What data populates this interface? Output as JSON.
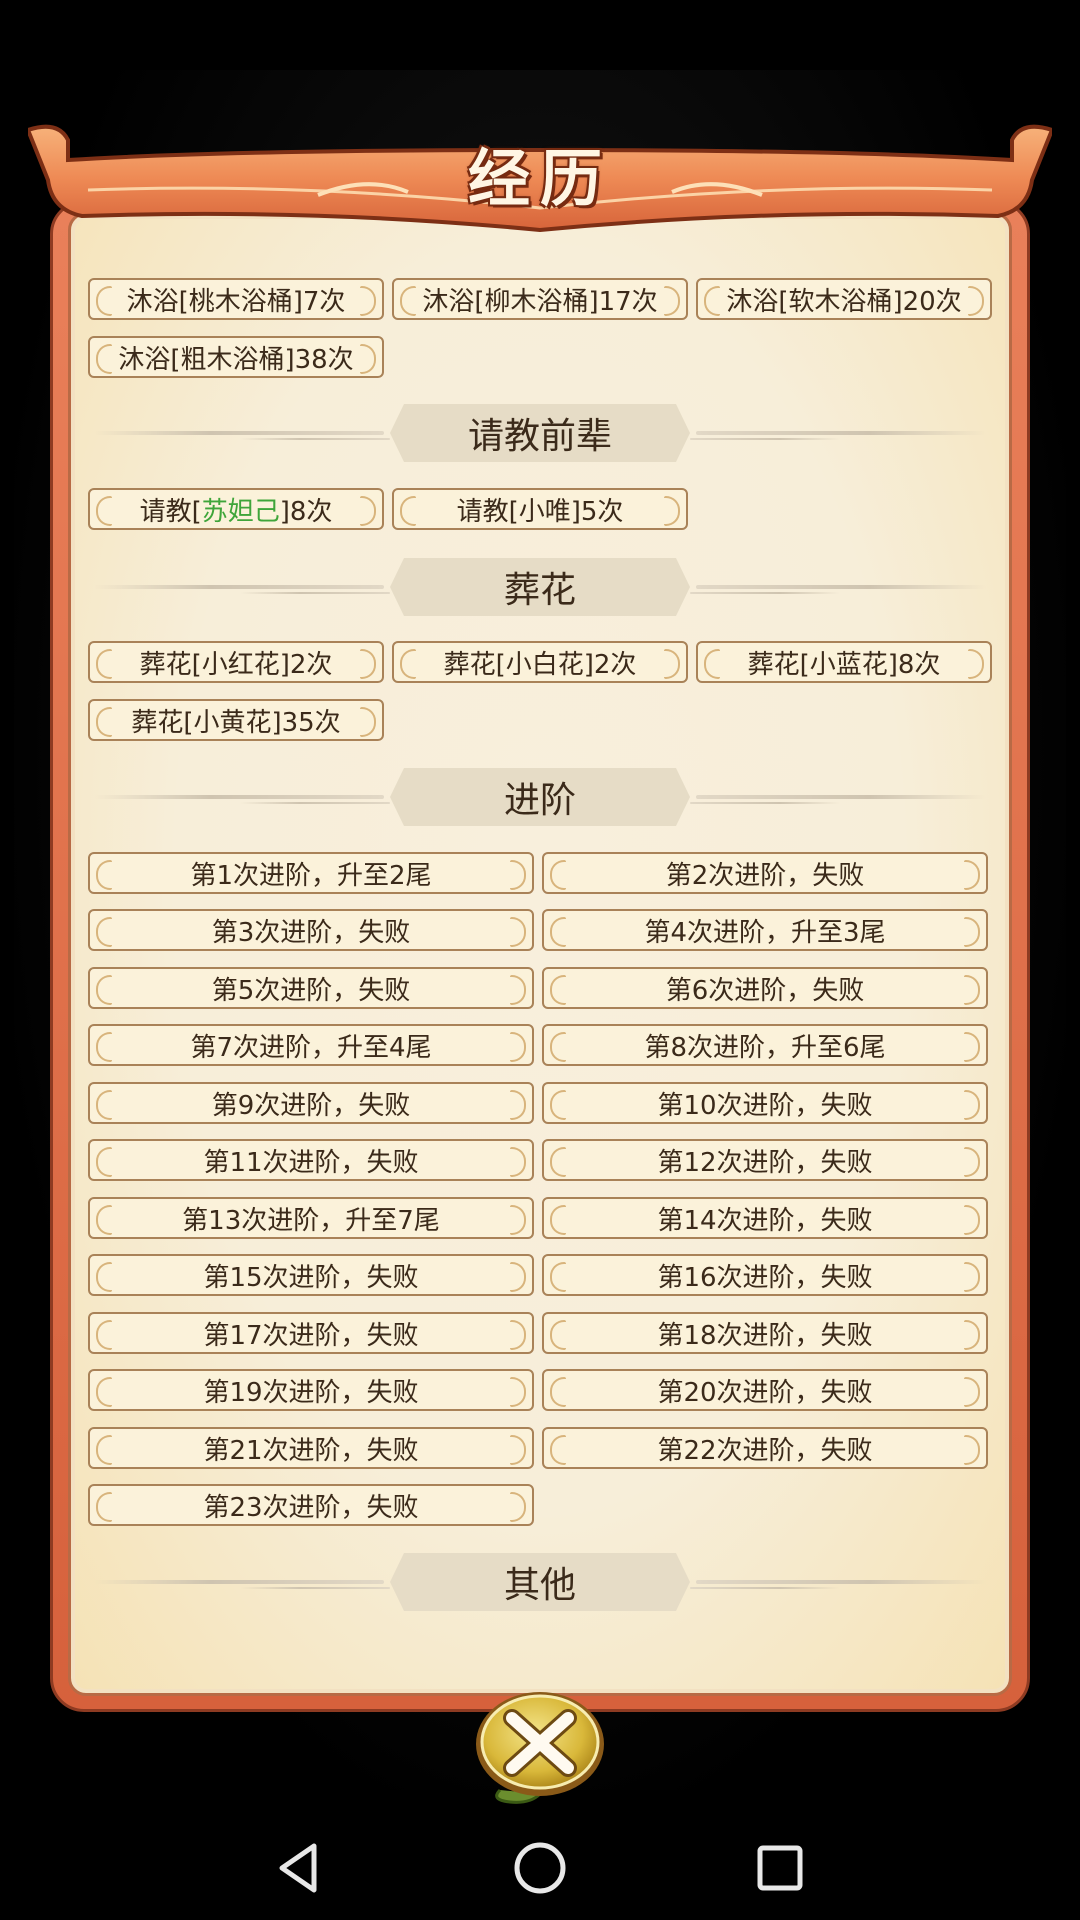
{
  "header": {
    "title": "经历"
  },
  "bath": {
    "items": [
      "沐浴[桃木浴桶]7次",
      "沐浴[柳木浴桶]17次",
      "沐浴[软木浴桶]20次",
      "沐浴[粗木浴桶]38次"
    ]
  },
  "consult": {
    "title": "请教前辈",
    "item1": {
      "prefix": "请教[",
      "name": "苏妲己",
      "suffix": "]8次"
    },
    "item2": "请教[小唯]5次",
    "highlight_color": "#3fa53a"
  },
  "flowers": {
    "title": "葬花",
    "items": [
      "葬花[小红花]2次",
      "葬花[小白花]2次",
      "葬花[小蓝花]8次",
      "葬花[小黄花]35次"
    ]
  },
  "advance": {
    "title": "进阶",
    "items": [
      "第1次进阶，升至2尾",
      "第2次进阶，失败",
      "第3次进阶，失败",
      "第4次进阶，升至3尾",
      "第5次进阶，失败",
      "第6次进阶，失败",
      "第7次进阶，升至4尾",
      "第8次进阶，升至6尾",
      "第9次进阶，失败",
      "第10次进阶，失败",
      "第11次进阶，失败",
      "第12次进阶，失败",
      "第13次进阶，升至7尾",
      "第14次进阶，失败",
      "第15次进阶，失败",
      "第16次进阶，失败",
      "第17次进阶，失败",
      "第18次进阶，失败",
      "第19次进阶，失败",
      "第20次进阶，失败",
      "第21次进阶，失败",
      "第22次进阶，失败",
      "第23次进阶，失败"
    ]
  },
  "other": {
    "title": "其他"
  },
  "icons": {
    "close": "close-x-icon",
    "back": "back-triangle-icon",
    "home": "home-circle-icon",
    "recents": "recents-square-icon"
  }
}
